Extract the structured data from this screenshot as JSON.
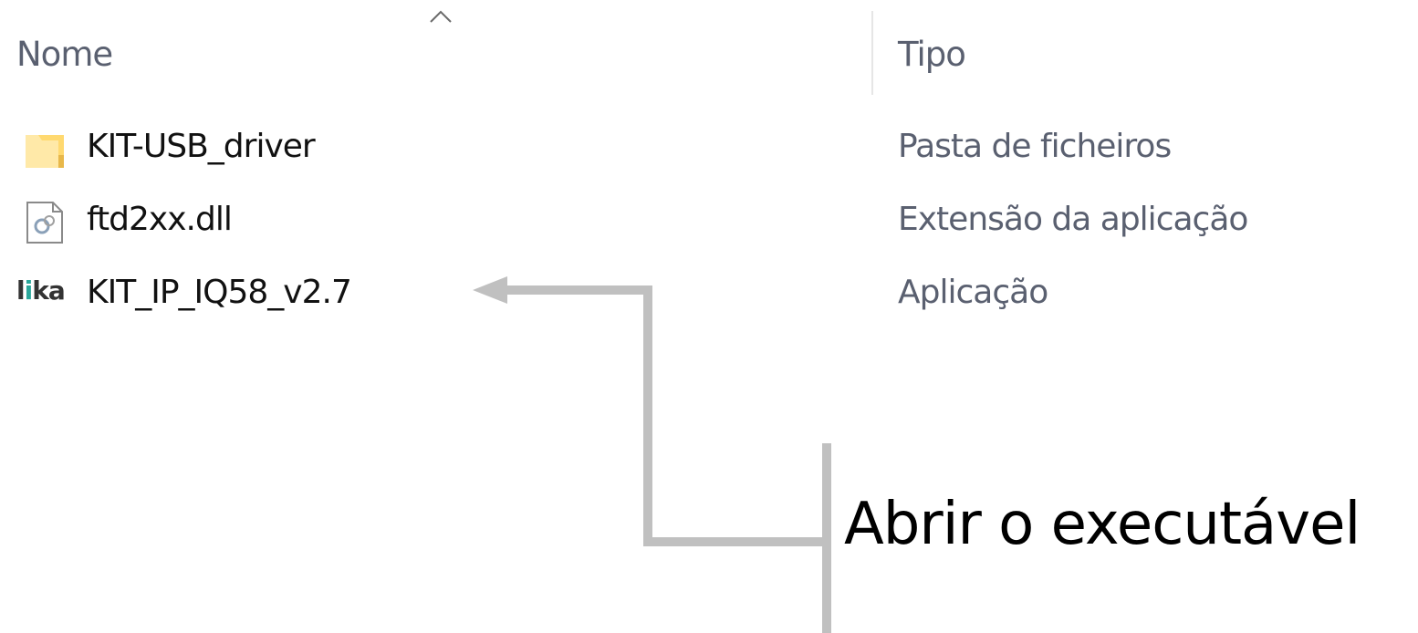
{
  "header": {
    "name_label": "Nome",
    "type_label": "Tipo",
    "sort_icon": "chevron-up-icon"
  },
  "files": [
    {
      "name": "KIT-USB_driver",
      "type": "Pasta de ficheiros",
      "icon": "folder-icon"
    },
    {
      "name": "ftd2xx.dll",
      "type": "Extensão da aplicação",
      "icon": "dll-file-icon"
    },
    {
      "name": "KIT_IP_IQ58_v2.7",
      "type": "Aplicação",
      "icon": "lika-app-icon",
      "icon_text": "lika"
    }
  ],
  "annotation": {
    "text": "Abrir o executável",
    "line_color": "#c0c0c0"
  },
  "colors": {
    "header_text": "#5a6070",
    "folder_yellow": "#ffd970",
    "lika_accent": "#2aa79b"
  }
}
